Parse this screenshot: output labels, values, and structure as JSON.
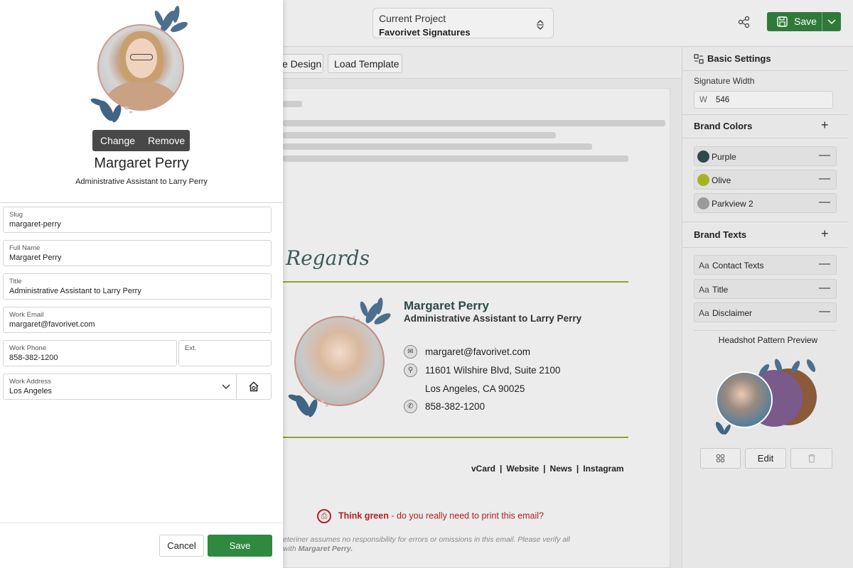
{
  "topbar": {
    "project_label": "Current Project",
    "project_name": "Favorivet Signatures",
    "save_label": "Save"
  },
  "toolbar": {
    "design_label": "e Design",
    "load_template_label": "Load Template"
  },
  "signature": {
    "regards": "Regards",
    "name": "Margaret Perry",
    "title": "Administrative Assistant to Larry Perry",
    "email": "margaret@favorivet.com",
    "address_line1": "11601 Wilshire Blvd, Suite 2100",
    "address_line2": "Los Angeles, CA 90025",
    "phone": "858-382-1200",
    "links": [
      "vCard",
      "Website",
      "News",
      "Instagram"
    ],
    "think_green_bold": "Think green",
    "think_green_rest": " - do you really need to print this email?",
    "disclaimer_line1": "eteriner assumes no responsibility for errors or omissions in this email. Please verify all",
    "disclaimer_line2_prefix": "with ",
    "disclaimer_line2_bold": "Margaret Perry."
  },
  "settings": {
    "title": "Basic Settings",
    "width_label": "Signature Width",
    "width_prefix": "W",
    "width_value": "546",
    "brand_colors_title": "Brand Colors",
    "brand_colors": [
      {
        "name": "Purple",
        "color": "#2d4a48"
      },
      {
        "name": "Olive",
        "color": "#a6b51f"
      },
      {
        "name": "Parkview 2",
        "color": "#9a9a9a"
      }
    ],
    "brand_texts_title": "Brand Texts",
    "brand_texts_prefix": "Aa",
    "brand_texts": [
      "Contact Texts",
      "Title",
      "Disclaimer"
    ],
    "headshot_preview_label": "Headshot Pattern Preview",
    "edit_label": "Edit"
  },
  "editor": {
    "change_label": "Change",
    "remove_label": "Remove",
    "name": "Margaret Perry",
    "title": "Administrative Assistant to Larry Perry",
    "fields": {
      "slug": {
        "label": "Slug",
        "value": "margaret-perry"
      },
      "full_name": {
        "label": "Full Name",
        "value": "Margaret Perry"
      },
      "title": {
        "label": "Title",
        "value": "Administrative Assistant to Larry Perry"
      },
      "work_email": {
        "label": "Work Email",
        "value": "margaret@favorivet.com"
      },
      "work_phone": {
        "label": "Work Phone",
        "value": "858-382-1200"
      },
      "ext": {
        "label": "Ext.",
        "value": ""
      },
      "work_address": {
        "label": "Work Address",
        "value": "Los Angeles"
      }
    },
    "cancel_label": "Cancel",
    "save_label": "Save"
  },
  "colors": {
    "accent_green": "#2f8a3f",
    "divider_olive": "#8ea52c",
    "signature_name": "#2b4a48"
  }
}
